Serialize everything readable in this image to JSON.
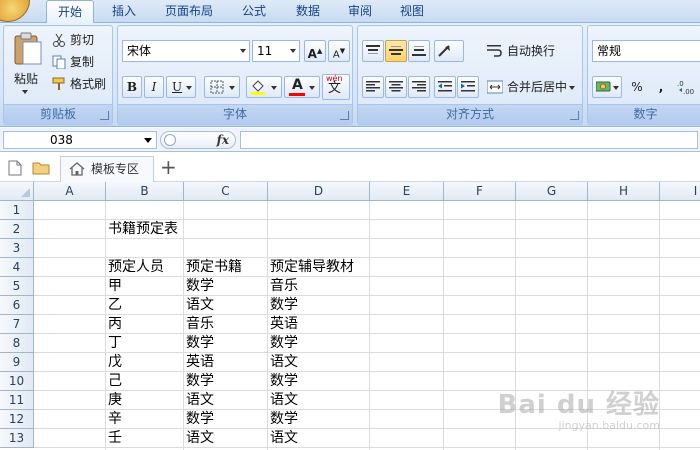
{
  "ribbon": {
    "tabs": [
      "开始",
      "插入",
      "页面布局",
      "公式",
      "数据",
      "审阅",
      "视图"
    ],
    "active_tab": "开始",
    "clipboard": {
      "paste_label": "粘贴",
      "cut_label": "剪切",
      "copy_label": "复制",
      "format_painter_label": "格式刷",
      "group_label": "剪贴板"
    },
    "font": {
      "font_name": "宋体",
      "font_size": "11",
      "bold": "B",
      "italic": "I",
      "underline": "U",
      "phonetic": "wén",
      "phonetic_char": "文",
      "font_color_char": "A",
      "grow_char": "A",
      "shrink_char": "A",
      "group_label": "字体"
    },
    "alignment": {
      "wrap_text_label": "自动换行",
      "merge_center_label": "合并后居中",
      "group_label": "对齐方式"
    },
    "number": {
      "format": "常规",
      "percent": "%",
      "comma": ",",
      "group_label": "数字"
    },
    "colors": {
      "accent": "#15428b",
      "highlight_fill": "#ffff00",
      "font_color": "#ff0000"
    }
  },
  "formula_bar": {
    "name_box": "038",
    "fx_label": "fx",
    "formula": ""
  },
  "doc_tabs": {
    "tab_label": "模板专区",
    "add_label": "+"
  },
  "sheet": {
    "columns": [
      "A",
      "B",
      "C",
      "D",
      "E",
      "F",
      "G",
      "H",
      "I"
    ],
    "rows": [
      "1",
      "2",
      "3",
      "4",
      "5",
      "6",
      "7",
      "8",
      "9",
      "10",
      "11",
      "12",
      "13"
    ],
    "title": "书籍预定表",
    "headers": [
      "预定人员",
      "预定书籍",
      "预定辅导教材"
    ],
    "records": [
      [
        "甲",
        "数学",
        "音乐"
      ],
      [
        "乙",
        "语文",
        "数学"
      ],
      [
        "丙",
        "音乐",
        "英语"
      ],
      [
        "丁",
        "数学",
        "数学"
      ],
      [
        "戊",
        "英语",
        "语文"
      ],
      [
        "己",
        "数学",
        "数学"
      ],
      [
        "庚",
        "语文",
        "语文"
      ],
      [
        "辛",
        "数学",
        "数学"
      ],
      [
        "壬",
        "语文",
        "语文"
      ]
    ]
  },
  "watermark": {
    "brand": "Bai du 经验",
    "url": "jingyan.baidu.com"
  }
}
